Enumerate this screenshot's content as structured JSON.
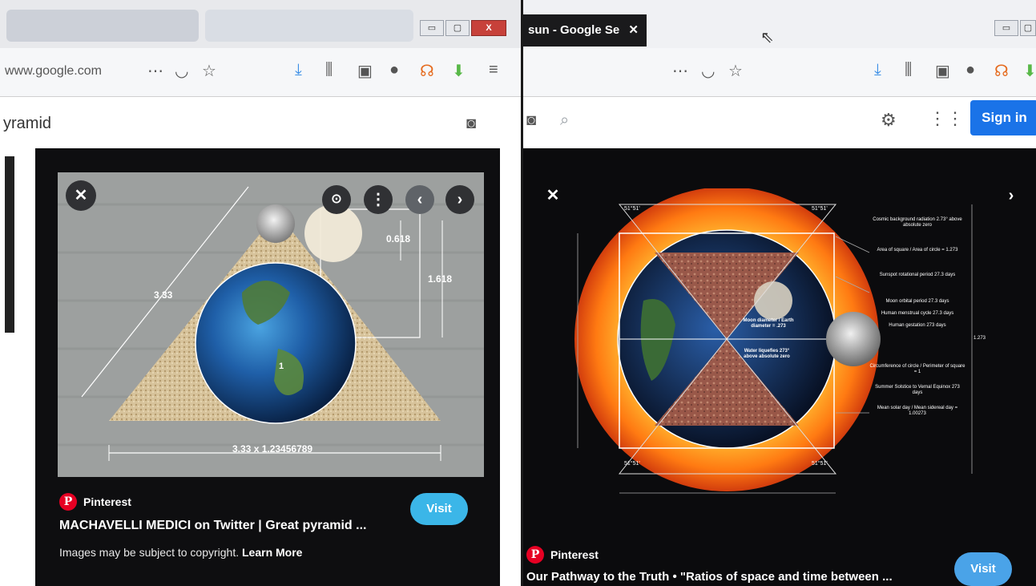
{
  "left_window": {
    "url": "www.google.com",
    "search_query": "yramid",
    "window_buttons": {
      "minimize": "▭",
      "maximize": "▢",
      "close": "X"
    },
    "viewer": {
      "source_name": "Pinterest",
      "title": "MACHAVELLI MEDICI on Twitter | Great pyramid ...",
      "copyright_text": "Images may be subject to copyright.",
      "learn_more": "Learn More",
      "visit_label": "Visit",
      "annotations": {
        "side": "3.33",
        "small": "0.618",
        "large": "1.618",
        "base": "3.33 x 1.23456789",
        "radius": "1"
      }
    }
  },
  "right_window": {
    "tab_title": "sun - Google Se",
    "sign_in_label": "Sign in",
    "viewer": {
      "source_name": "Pinterest",
      "title": "Our Pathway to the Truth • \"Ratios of space and time between ...",
      "visit_label": "Visit",
      "annotations": [
        "Cosmic background radiation 2.73° above absolute zero",
        "Area of square / Area of circle = 1.273",
        "Sunspot rotational period 27.3 days",
        "Moon orbital period 27.3 days",
        "Human menstrual cycle 27.3 days",
        "Human gestation 273 days",
        "Circumference of circle / Perimeter of square = 1",
        "Summer Solstice to Vernal Equinox 273 days",
        "Mean solar day / Mean sidereal day = 1.00273",
        "1.273",
        "Water liquefies 273° above absolute zero",
        "Moon diameter / Earth diameter = .273"
      ],
      "angles": [
        "51°51'",
        "51°51'",
        "51°51'",
        "51°51'"
      ]
    }
  },
  "colors": {
    "google_blue": "#1a73e8",
    "pinterest_red": "#e60023",
    "visit_cyan": "#3bb6e8",
    "viewer_bg": "#0e0e10"
  }
}
